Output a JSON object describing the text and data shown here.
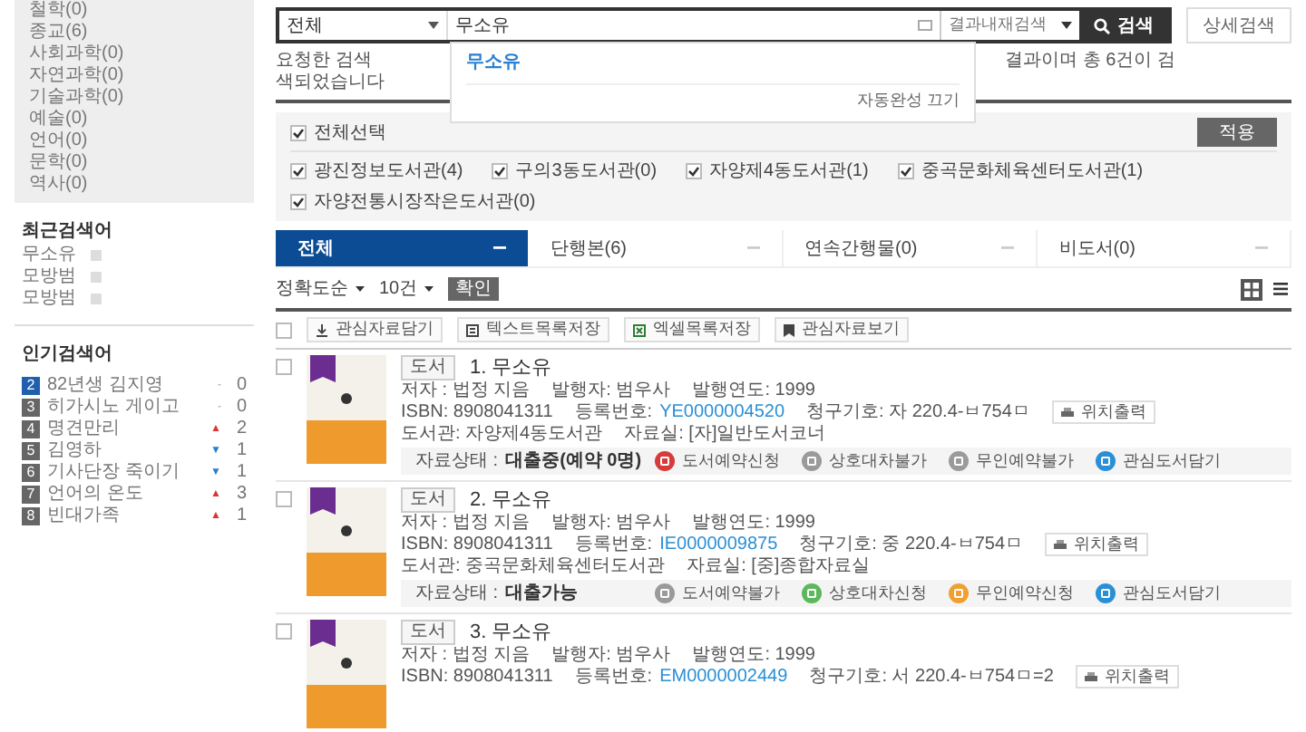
{
  "sidebar": {
    "categories": [
      "철학(0)",
      "종교(6)",
      "사회과학(0)",
      "자연과학(0)",
      "기술과학(0)",
      "예술(0)",
      "언어(0)",
      "문학(0)",
      "역사(0)"
    ],
    "recent": {
      "title": "최근검색어",
      "items": [
        "무소유",
        "모방범",
        "모방범"
      ]
    },
    "popular": {
      "title": "인기검색어",
      "items": [
        {
          "rank": "2",
          "highlighted": true,
          "term": "82년생 김지영",
          "kind": "same",
          "marker": "-",
          "change": "0"
        },
        {
          "rank": "3",
          "highlighted": false,
          "term": "히가시노 게이고",
          "kind": "same",
          "marker": "-",
          "change": "0"
        },
        {
          "rank": "4",
          "highlighted": false,
          "term": "명견만리",
          "kind": "up",
          "marker": "▲",
          "change": "2"
        },
        {
          "rank": "5",
          "highlighted": false,
          "term": "김영하",
          "kind": "down",
          "marker": "▼",
          "change": "1"
        },
        {
          "rank": "6",
          "highlighted": false,
          "term": "기사단장 죽이기",
          "kind": "down",
          "marker": "▼",
          "change": "1"
        },
        {
          "rank": "7",
          "highlighted": false,
          "term": "언어의 온도",
          "kind": "up",
          "marker": "▲",
          "change": "3"
        },
        {
          "rank": "8",
          "highlighted": false,
          "term": "빈대가족",
          "kind": "up",
          "marker": "▲",
          "change": "1"
        }
      ]
    }
  },
  "search": {
    "scope": "전체",
    "query": "무소유",
    "mode": "결과내재검색",
    "button": "검색",
    "advanced": "상세검색",
    "autocomplete": {
      "suggestion": "무소유",
      "off": "자동완성 끄기"
    }
  },
  "notice": {
    "line_1_start": "요청한 검색",
    "line_1_end": "결과이며 총 6건이 검",
    "line_2": "색되었습니다"
  },
  "filter": {
    "select_all": {
      "label": "전체선택",
      "checked": true
    },
    "apply": "적용",
    "libraries": [
      {
        "label": "광진정보도서관(4)",
        "checked": true
      },
      {
        "label": "구의3동도서관(0)",
        "checked": true
      },
      {
        "label": "자양제4동도서관(1)",
        "checked": true
      },
      {
        "label": "중곡문화체육센터도서관(1)",
        "checked": true
      },
      {
        "label": "자양전통시장작은도서관(0)",
        "checked": true
      }
    ]
  },
  "tabs": [
    {
      "label": "전체",
      "selected": true
    },
    {
      "label": "단행본(6)",
      "selected": false
    },
    {
      "label": "연속간행물(0)",
      "selected": false
    },
    {
      "label": "비도서(0)",
      "selected": false
    }
  ],
  "sort": {
    "order": "정확도순",
    "count": "10건",
    "confirm": "확인",
    "views": [
      {
        "kind": "grid",
        "selected": true
      },
      {
        "kind": "list",
        "selected": false
      }
    ]
  },
  "toolbar": {
    "checked": false,
    "actions": [
      {
        "kind": "download",
        "label": "관심자료담기"
      },
      {
        "kind": "text",
        "label": "텍스트목록저장"
      },
      {
        "kind": "excel",
        "label": "엑셀목록저장"
      },
      {
        "kind": "bookmark",
        "label": "관심자료보기"
      }
    ]
  },
  "results": [
    {
      "checked": false,
      "type": "도서",
      "title": "1. 무소유",
      "author": "저자 : 법정 지음",
      "publisher": "발행자: 범우사",
      "year": "발행연도: 1999",
      "isbn": "ISBN: 8908041311",
      "reg_label": "등록번호:",
      "reg_no": "YE0000004520",
      "call_no": "청구기호: 자 220.4-ㅂ754ㅁ",
      "print": "위치출력",
      "library": "도서관: 자양제4동도서관",
      "room": "자료실: [자]일반도서코너",
      "status_label": "자료상태 :",
      "status": "대출중(예약 0명)",
      "actions": [
        {
          "label": "도서예약신청",
          "color": "#d63b3b"
        },
        {
          "label": "상호대차불가",
          "color": "#9a9a9a"
        },
        {
          "label": "무인예약불가",
          "color": "#9a9a9a"
        },
        {
          "label": "관심도서담기",
          "color": "#2a8fd6"
        }
      ]
    },
    {
      "checked": false,
      "type": "도서",
      "title": "2. 무소유",
      "author": "저자 : 법정 지음",
      "publisher": "발행자: 범우사",
      "year": "발행연도: 1999",
      "isbn": "ISBN: 8908041311",
      "reg_label": "등록번호:",
      "reg_no": "IE0000009875",
      "call_no": "청구기호: 중 220.4-ㅂ754ㅁ",
      "print": "위치출력",
      "library": "도서관: 중곡문화체육센터도서관",
      "room": "자료실: [중]종합자료실",
      "status_label": "자료상태 :",
      "status": "대출가능",
      "actions": [
        {
          "label": "도서예약불가",
          "color": "#9a9a9a"
        },
        {
          "label": "상호대차신청",
          "color": "#5cb85c"
        },
        {
          "label": "무인예약신청",
          "color": "#f0a030"
        },
        {
          "label": "관심도서담기",
          "color": "#2a8fd6"
        }
      ]
    },
    {
      "checked": false,
      "type": "도서",
      "title": "3. 무소유",
      "author": "저자 : 법정 지음",
      "publisher": "발행자: 범우사",
      "year": "발행연도: 1999",
      "isbn": "ISBN: 8908041311",
      "reg_label": "등록번호:",
      "reg_no": "EM0000002449",
      "call_no": "청구기호: 서 220.4-ㅂ754ㅁ=2",
      "print": "위치출력"
    }
  ]
}
